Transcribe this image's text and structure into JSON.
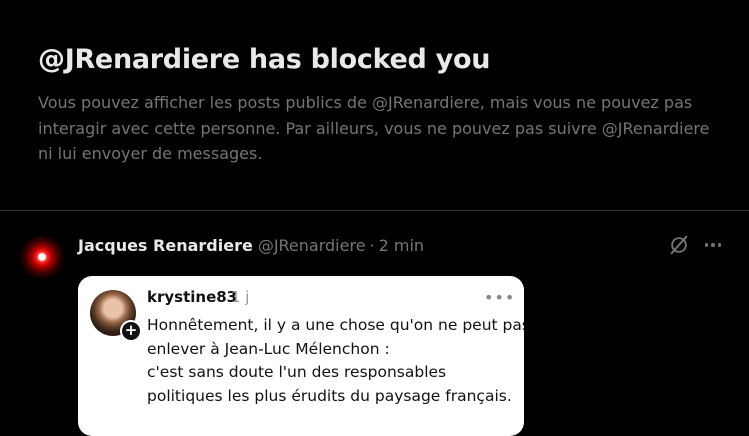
{
  "blocked_notice": {
    "title": "@JRenardiere has blocked you",
    "message": "Vous pouvez afficher les posts publics de @JRenardiere, mais vous ne pouvez pas interagir avec cette personne. Par ailleurs, vous ne pouvez pas suivre @JRenardiere ni lui envoyer de messages."
  },
  "post": {
    "author_name": "Jacques Renardiere",
    "handle": "@JRenardiere",
    "separator": "·",
    "time": "2 min",
    "icons": {
      "grok": "grok-slash-icon",
      "more": "more-options-icon"
    },
    "media": {
      "username": "krystine83",
      "age": "1 j",
      "menu": "•••",
      "lines": [
        "Honnêtement, il y a une chose qu'on ne peut pas",
        "enlever à Jean-Luc Mélenchon :",
        "c'est sans doute l'un des responsables",
        "politiques les plus érudits du paysage français."
      ]
    }
  },
  "colors": {
    "background": "#000000",
    "primary_text": "#e7e9ea",
    "secondary_text": "#71767b",
    "divider": "#2f3336"
  }
}
